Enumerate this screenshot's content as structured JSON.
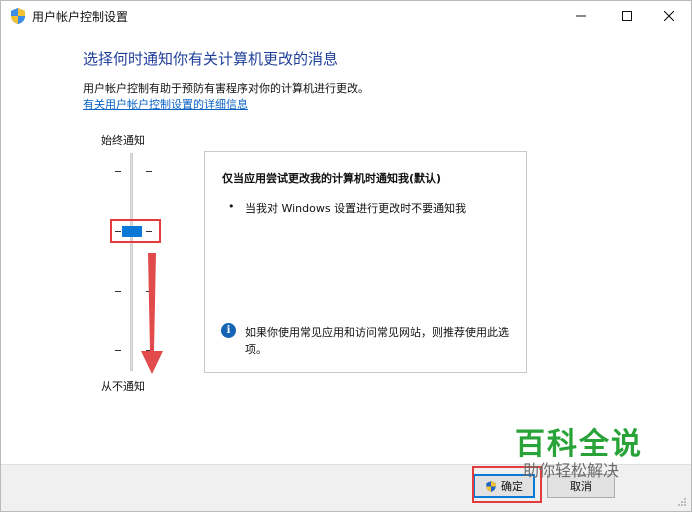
{
  "window": {
    "title": "用户帐户控制设置",
    "icons": {
      "app": "uac-shield-icon",
      "minimize": "minimize-icon",
      "maximize": "maximize-icon",
      "close": "close-icon"
    }
  },
  "main": {
    "heading": "选择何时通知你有关计算机更改的消息",
    "description": "用户帐户控制有助于预防有害程序对你的计算机进行更改。",
    "link": "有关用户帐户控制设置的详细信息"
  },
  "slider": {
    "top_label": "始终通知",
    "bottom_label": "从不通知",
    "levels": 4,
    "selected_level": 3
  },
  "info_panel": {
    "title": "仅当应用尝试更改我的计算机时通知我(默认)",
    "bullet": "•",
    "bullet_text": "当我对 Windows 设置进行更改时不要通知我",
    "note_icon": "i",
    "note_text": "如果你使用常见应用和访问常见网站，则推荐使用此选项。"
  },
  "footer": {
    "ok_label": "确定",
    "cancel_label": "取消"
  },
  "watermark": {
    "line1": "百科全说",
    "line2": "助你轻松解决"
  },
  "colors": {
    "accent": "#0a78d7",
    "heading": "#1f3f99",
    "link": "#0b63c5",
    "annotation": "#e43c3c",
    "watermark_green": "#27a337"
  }
}
